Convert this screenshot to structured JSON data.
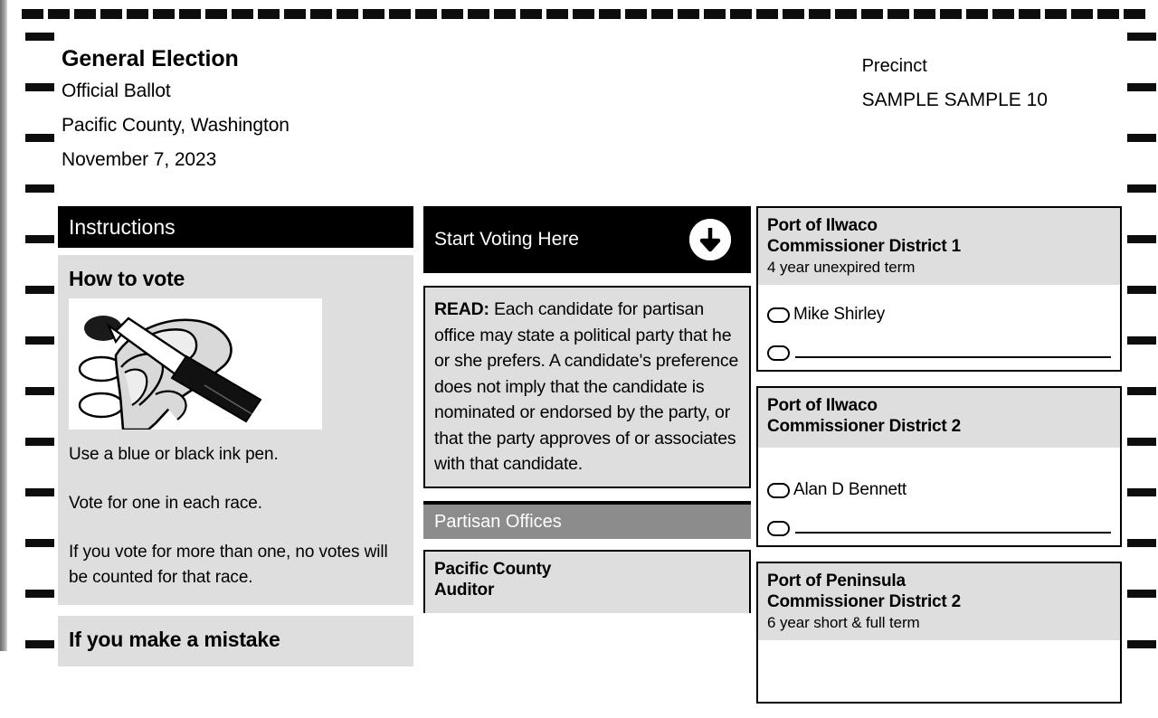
{
  "header": {
    "title": "General Election",
    "line2": "Official Ballot",
    "line3": "Pacific County, Washington",
    "line4": "November 7, 2023",
    "precinct_label": "Precinct",
    "precinct_value": "SAMPLE SAMPLE 10"
  },
  "instructions": {
    "bar_label": "Instructions",
    "how_to_vote_heading": "How to vote",
    "figure_name": "hand-holding-pen-filling-oval",
    "line_pen": "Use a blue or black ink pen.",
    "line_one_race": "Vote for one in each race.",
    "line_overvote": "If you vote for more than one, no votes will be counted for that race.",
    "mistake_heading": "If you make a mistake"
  },
  "voting": {
    "start_label": "Start Voting Here",
    "arrow_icon": "arrow-down-circle-icon",
    "read_prefix": "READ:",
    "read_text": " Each candidate for partisan office may state a political party that he or she prefers.  A candidate's preference does not imply that the candidate is nominated or endorsed by the party, or that the party approves of or associates with that candidate.",
    "partisan_bar_label": "Partisan Offices",
    "partisan_contest": {
      "title_line1": "Pacific County",
      "title_line2": "Auditor"
    }
  },
  "contests": [
    {
      "title_line1": "Port of Ilwaco",
      "title_line2": "Commissioner District 1",
      "term": "4 year unexpired term",
      "candidates": [
        "Mike Shirley"
      ],
      "write_in": true
    },
    {
      "title_line1": "Port of Ilwaco",
      "title_line2": "Commissioner District 2",
      "term": "",
      "candidates": [
        "Alan D Bennett"
      ],
      "write_in": true
    },
    {
      "title_line1": "Port of Peninsula",
      "title_line2": "Commissioner District 2",
      "term": "6 year short & full term",
      "candidates": [],
      "write_in": false
    }
  ],
  "colors": {
    "bar_black": "#000000",
    "bar_gray": "#8c8c8c",
    "panel_gray": "#dedede",
    "paper": "#ffffff",
    "ink": "#000000"
  }
}
